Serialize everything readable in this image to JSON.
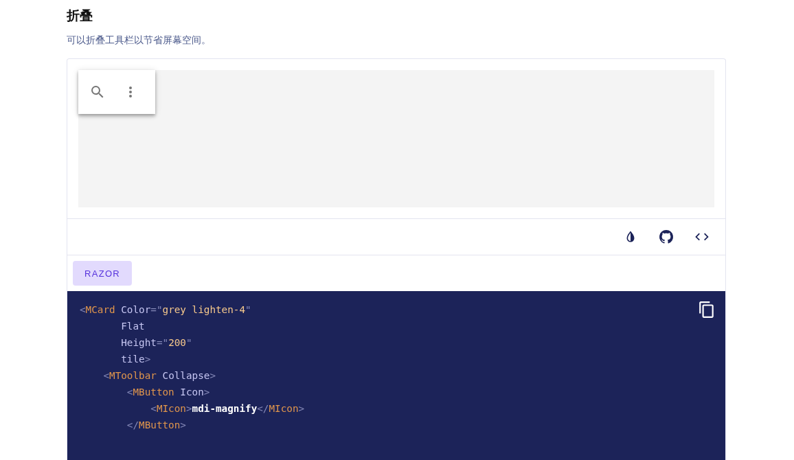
{
  "section": {
    "title": "折叠",
    "description": "可以折叠工具栏以节省屏幕空间。"
  },
  "demo": {
    "toolbar": {
      "collapsed": true,
      "buttons": [
        {
          "kind": "search"
        },
        {
          "kind": "more"
        }
      ]
    }
  },
  "actions": [
    {
      "kind": "theme"
    },
    {
      "kind": "github"
    },
    {
      "kind": "code"
    }
  ],
  "code_tabs": [
    {
      "label": "RAZOR",
      "selected": true
    }
  ],
  "code": {
    "lines": [
      [
        {
          "kind": "punct",
          "text": "<"
        },
        {
          "kind": "tag",
          "text": "MCard"
        },
        {
          "kind": "attr",
          "text": " Color"
        },
        {
          "kind": "punct",
          "text": "=\""
        },
        {
          "kind": "string",
          "text": "grey lighten-4"
        },
        {
          "kind": "punct",
          "text": "\""
        }
      ],
      [
        {
          "kind": "attr",
          "text": "       Flat"
        }
      ],
      [
        {
          "kind": "attr",
          "text": "       Height"
        },
        {
          "kind": "punct",
          "text": "=\""
        },
        {
          "kind": "string",
          "text": "200"
        },
        {
          "kind": "punct",
          "text": "\""
        }
      ],
      [
        {
          "kind": "attr",
          "text": "       tile"
        },
        {
          "kind": "punct",
          "text": ">"
        }
      ],
      [
        {
          "kind": "punct",
          "text": "    <"
        },
        {
          "kind": "tag",
          "text": "MToolbar"
        },
        {
          "kind": "attr",
          "text": " Collapse"
        },
        {
          "kind": "punct",
          "text": ">"
        }
      ],
      [
        {
          "kind": "punct",
          "text": "        <"
        },
        {
          "kind": "tag",
          "text": "MButton"
        },
        {
          "kind": "attr",
          "text": " Icon"
        },
        {
          "kind": "punct",
          "text": ">"
        }
      ],
      [
        {
          "kind": "punct",
          "text": "            <"
        },
        {
          "kind": "tag",
          "text": "MIcon"
        },
        {
          "kind": "punct",
          "text": ">"
        },
        {
          "kind": "text",
          "text": "mdi-magnify"
        },
        {
          "kind": "punct",
          "text": "</"
        },
        {
          "kind": "tag",
          "text": "MIcon"
        },
        {
          "kind": "punct",
          "text": ">"
        }
      ],
      [
        {
          "kind": "punct",
          "text": "        </"
        },
        {
          "kind": "tag",
          "text": "MButton"
        },
        {
          "kind": "punct",
          "text": ">"
        }
      ]
    ]
  }
}
